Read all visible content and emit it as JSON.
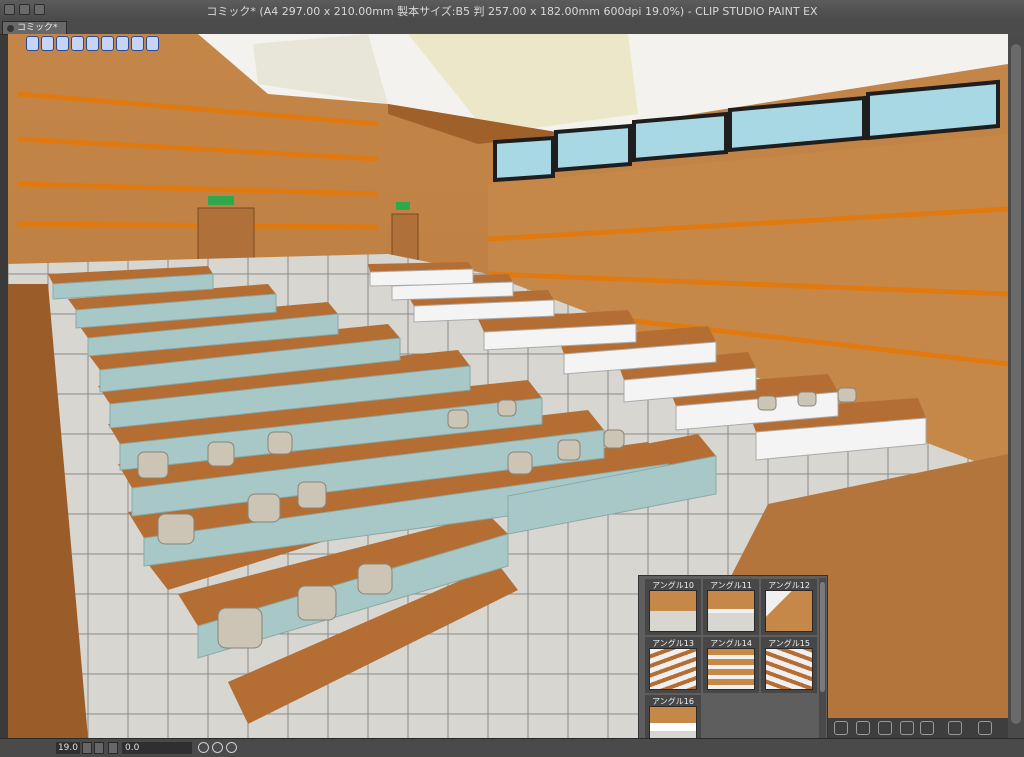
{
  "window": {
    "title": "コミック* (A4 297.00 x 210.00mm 製本サイズ:B5 判 257.00 x 182.00mm 600dpi 19.0%)  - CLIP STUDIO PAINT EX"
  },
  "tabs": [
    {
      "label": "コミック*"
    }
  ],
  "camera_tools": [
    "rotate-camera-icon",
    "pan-camera-icon",
    "dolly-camera-icon",
    "move-object-icon",
    "rotate-object-icon",
    "object-plane-icon",
    "scale-object-icon",
    "reset-icon",
    "settings-icon"
  ],
  "angles": [
    {
      "label": "アングル10"
    },
    {
      "label": "アングル11"
    },
    {
      "label": "アングル12"
    },
    {
      "label": "アングル13"
    },
    {
      "label": "アングル14"
    },
    {
      "label": "アングル15"
    },
    {
      "label": "アングル16"
    }
  ],
  "status": {
    "zoom": "19.0",
    "rotation": "0.0"
  },
  "colors": {
    "wall": "#c88a4a",
    "stripe": "#e07a10",
    "desk": "#b06a30",
    "desk_front": "#a8c8c8",
    "floor": "#d8d8d4",
    "ceiling": "#f2f2ee",
    "window": "#a8d8e4"
  }
}
